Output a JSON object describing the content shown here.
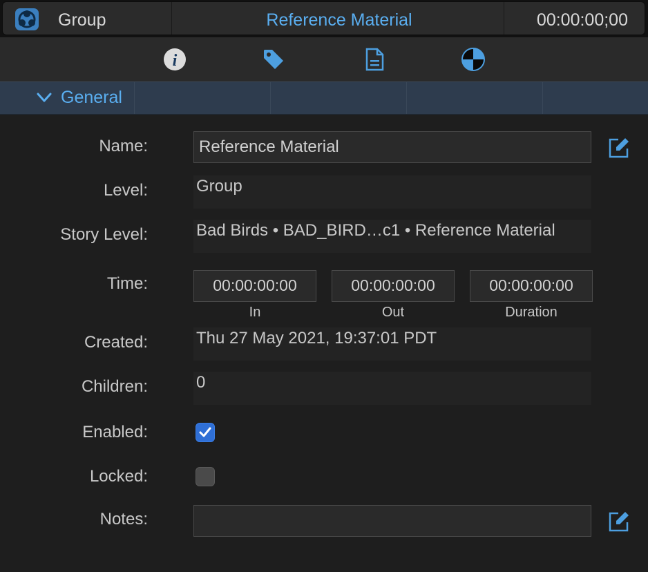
{
  "header": {
    "type_label": "Group",
    "title": "Reference Material",
    "timecode": "00:00:00;00",
    "accent": "#5aaef0"
  },
  "tabs": [
    {
      "icon": "info-icon"
    },
    {
      "icon": "tag-icon"
    },
    {
      "icon": "document-icon"
    },
    {
      "icon": "color-wheel-icon"
    }
  ],
  "section": {
    "label": "General",
    "expanded": true
  },
  "form": {
    "name_label": "Name:",
    "name_value": "Reference Material",
    "level_label": "Level:",
    "level_value": "Group",
    "story_label": "Story Level:",
    "story_value": "Bad Birds • BAD_BIRD…c1 • Reference Material",
    "time_label": "Time:",
    "time_in": "00:00:00:00",
    "time_out": "00:00:00:00",
    "time_duration": "00:00:00:00",
    "in_label": "In",
    "out_label": "Out",
    "duration_label": "Duration",
    "created_label": "Created:",
    "created_value": "Thu 27 May 2021, 19:37:01 PDT",
    "children_label": "Children:",
    "children_value": "0",
    "enabled_label": "Enabled:",
    "enabled": true,
    "locked_label": "Locked:",
    "locked": false,
    "notes_label": "Notes:",
    "notes_value": ""
  }
}
